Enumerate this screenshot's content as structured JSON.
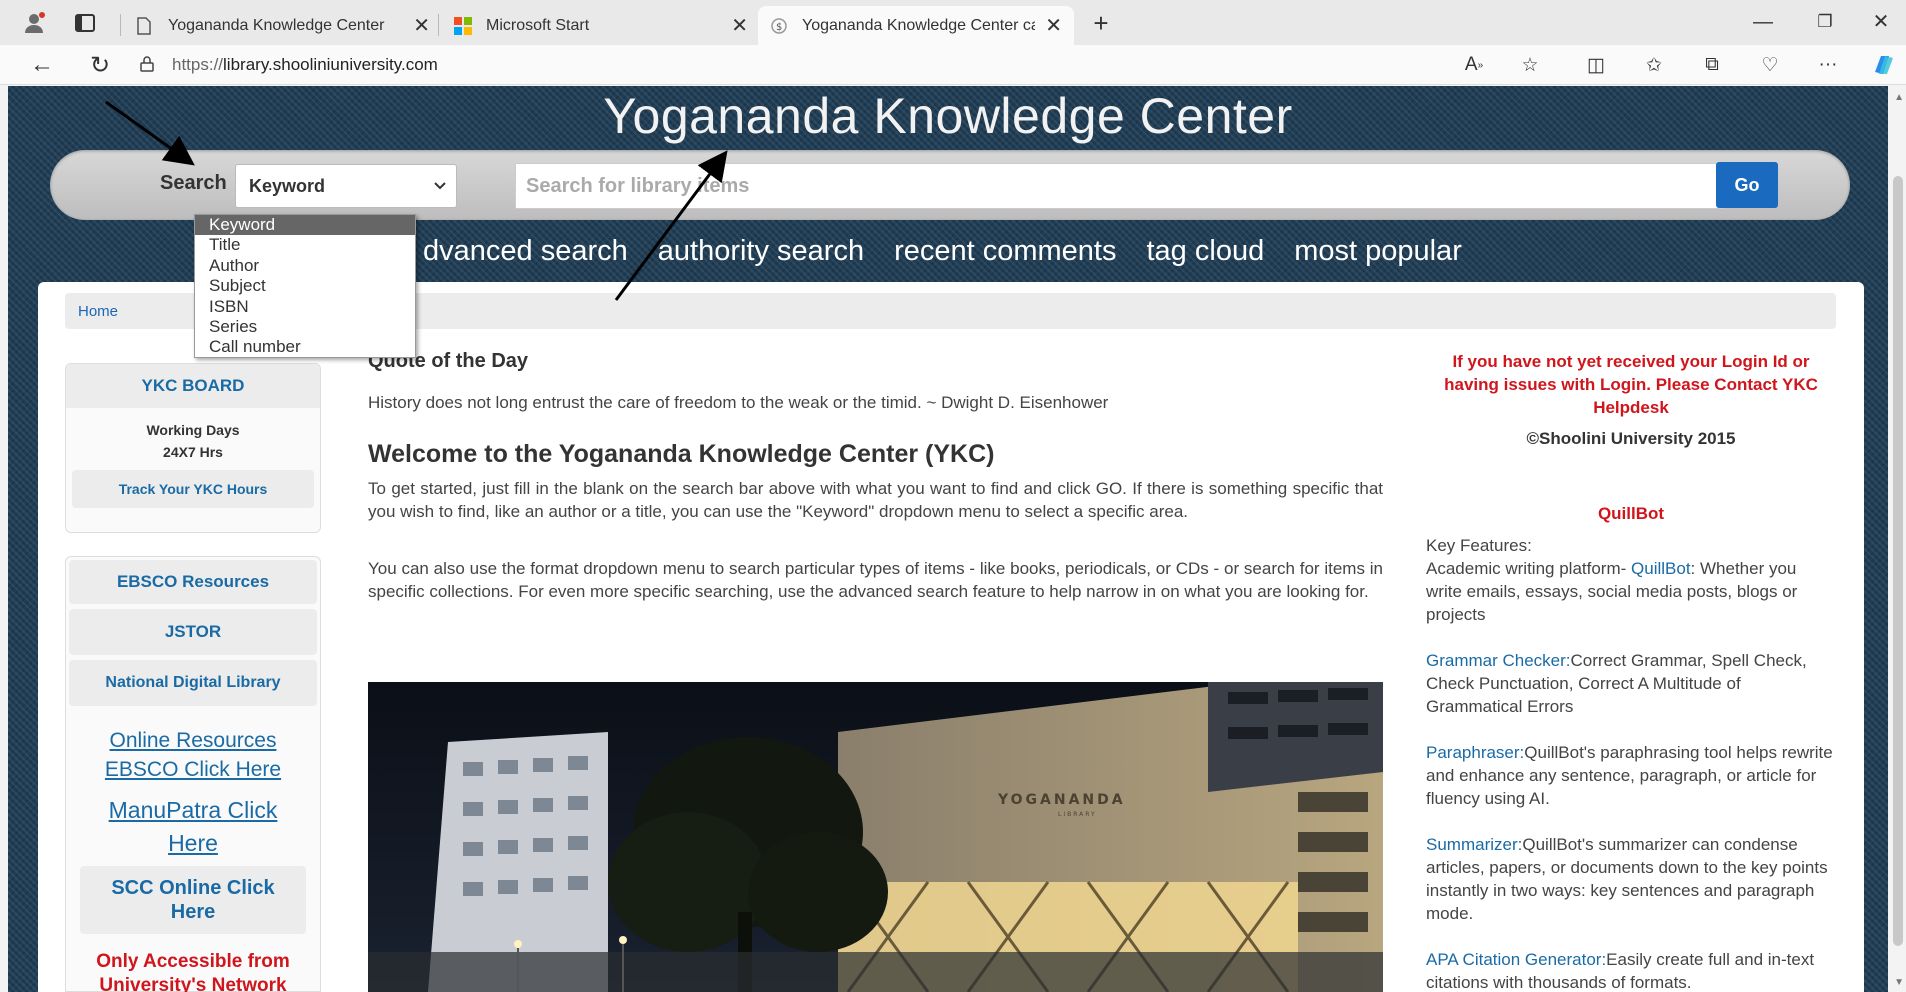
{
  "browser": {
    "tabs": [
      {
        "title": "Yogananda Knowledge Center",
        "active": false
      },
      {
        "title": "Microsoft Start",
        "active": false
      },
      {
        "title": "Yogananda Knowledge Center ca",
        "active": true
      }
    ],
    "new_tab": "+",
    "url_protocol": "https://",
    "url_host": "library.shooliniuniversity.com",
    "accent_color": "#1a6ac0"
  },
  "header": {
    "title": "Yogananda Knowledge Center"
  },
  "search": {
    "label": "Search",
    "selected": "Keyword",
    "placeholder": "Search for library items",
    "go_label": "Go",
    "options": [
      "Keyword",
      "Title",
      "Author",
      "Subject",
      "ISBN",
      "Series",
      "Call number"
    ],
    "nav_links": [
      "dvanced search",
      "authority search",
      "recent comments",
      "tag cloud",
      "most popular"
    ]
  },
  "breadcrumb": {
    "home": "Home"
  },
  "sidebar": {
    "board_title": "YKC BOARD",
    "working_days": "Working Days",
    "hours": "24X7 Hrs",
    "track_button": "Track Your YKC Hours",
    "resources": [
      "EBSCO Resources",
      "JSTOR",
      "National Digital Library"
    ],
    "online_resources_1": "Online Resources",
    "online_resources_2": "EBSCO Click Here",
    "manupatra_1": "ManuPatra Click",
    "manupatra_2": "Here",
    "scc_1": "SCC Online Click",
    "scc_2": "Here",
    "access_note_1": "Only Accessible from",
    "access_note_2": "University's Network"
  },
  "main": {
    "quote_heading": "Quote of the Day",
    "quote_text": "History does not long entrust the care of freedom to the weak or the timid. ~ Dwight D. Eisenhower",
    "welcome_heading": "Welcome to the Yogananda Knowledge Center (YKC)",
    "para1": "To get started, just fill in the blank on the search bar above with what you want to find and click GO. If there is something specific that you wish to find, like an author or a title, you can use the \"Keyword\" dropdown menu to select a specific area.",
    "para2": "You can also use the format dropdown menu to search particular types of items - like books, periodicals, or CDs - or search for items in specific collections. For even more specific searching, use the advanced search feature to help narrow in on what you are looking for.",
    "building_sign": "YOGANANDA",
    "building_sign_sub": "LIBRARY"
  },
  "right": {
    "login_alert": "If you have not yet received your Login Id or having issues with Login. Please Contact YKC Helpdesk",
    "copyright": "©Shoolini University 2015",
    "quillbot_title": "QuillBot",
    "key_features": "Key Features:",
    "feat1_pre": "Academic writing platform- ",
    "feat1_link": "QuillBot",
    "feat1_post": ": Whether you write emails, essays, social media posts, blogs or projects",
    "feat2_link": "Grammar Checker:",
    "feat2_text": "Correct Grammar, Spell Check, Check Punctuation, Correct A Multitude of Grammatical Errors",
    "feat3_link": "Paraphraser:",
    "feat3_text": "QuillBot's paraphrasing tool helps rewrite and enhance any sentence, paragraph, or article for fluency using AI.",
    "feat4_link": "Summarizer:",
    "feat4_text": "QuillBot's summarizer can condense articles, papers, or documents down to the key points instantly in two ways: key sentences and paragraph mode.",
    "feat5_link": "APA Citation Generator:",
    "feat5_text": "Easily create full and in-text citations with thousands of formats."
  }
}
